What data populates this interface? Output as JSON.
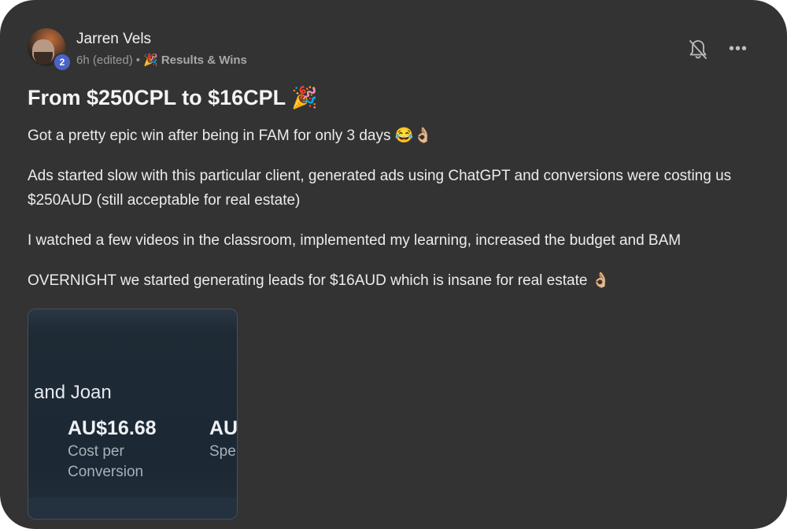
{
  "post": {
    "author": "Jarren Vels",
    "level": "2",
    "time": "6h (edited)",
    "separator": "•",
    "category_emoji": "🎉",
    "category": "Results & Wins",
    "title": "From $250CPL to $16CPL 🎉",
    "paragraphs": [
      "Got a pretty epic win after being in FAM for only 3 days 😂👌🏼",
      "Ads started slow with this particular client, generated ads using ChatGPT and conversions were costing us $250AUD (still acceptable for real estate)",
      "I watched a few videos in the classroom, implemented my learning, increased the budget and BAM",
      "OVERNIGHT we started generating leads for $16AUD which is insane for real estate 👌🏼"
    ],
    "icons": {
      "notifications": "bell-off-icon",
      "more": "more-horizontal-icon"
    },
    "more_glyph": "•••"
  },
  "attachment": {
    "name_text": "and Joan",
    "stats": [
      {
        "value": "AU$16.68",
        "label": "Cost per Conversion"
      },
      {
        "value": "AU",
        "label": "Spe"
      }
    ]
  },
  "colors": {
    "card_background": "#333333",
    "level_badge": "#4a63c9",
    "attachment_background": "#1e2a35"
  }
}
